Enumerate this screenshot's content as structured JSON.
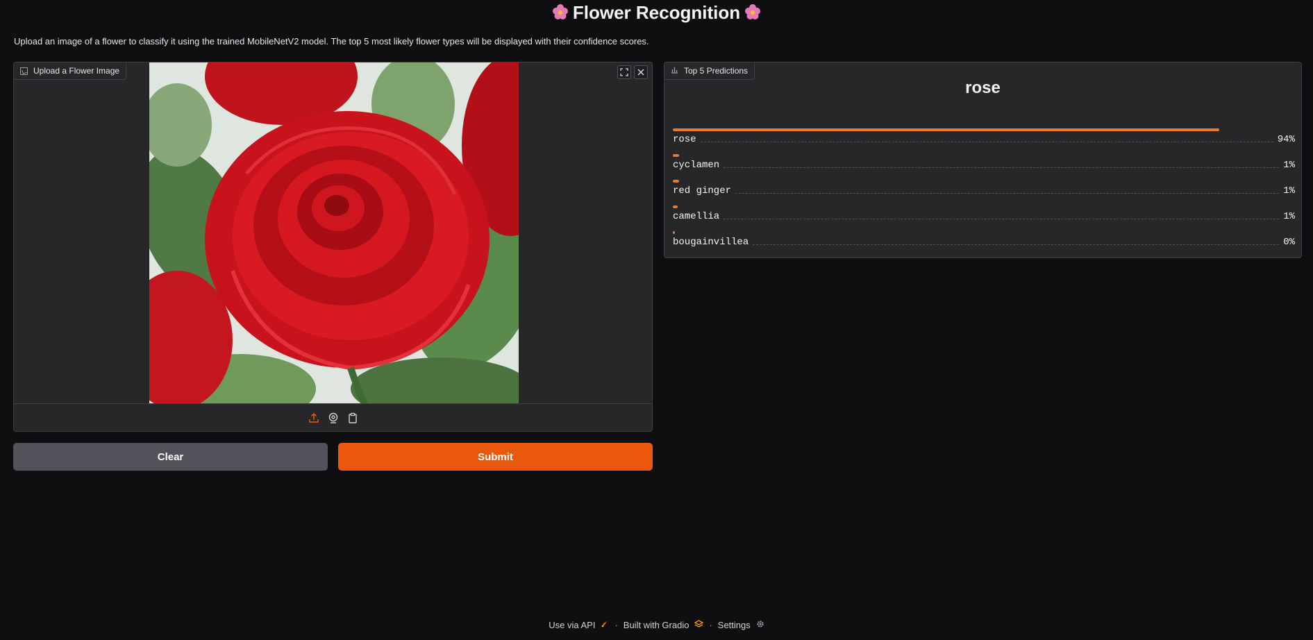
{
  "header": {
    "title": "Flower Recognition",
    "description": "Upload an image of a flower to classify it using the trained MobileNetV2 model. The top 5 most likely flower types will be displayed with their confidence scores."
  },
  "image_input": {
    "label": "Upload a Flower Image",
    "icons": [
      "image-icon",
      "fullscreen-icon",
      "close-icon",
      "upload-icon",
      "webcam-icon",
      "clipboard-icon"
    ]
  },
  "buttons": {
    "clear": "Clear",
    "submit": "Submit"
  },
  "predictions": {
    "label": "Top 5 Predictions",
    "top_label": "rose",
    "items": [
      {
        "name": "rose",
        "percent": "94%",
        "fraction": 0.94
      },
      {
        "name": "cyclamen",
        "percent": "1%",
        "fraction": 0.011
      },
      {
        "name": "red ginger",
        "percent": "1%",
        "fraction": 0.011
      },
      {
        "name": "camellia",
        "percent": "1%",
        "fraction": 0.008
      },
      {
        "name": "bougainvillea",
        "percent": "0%",
        "fraction": 0.004
      }
    ]
  },
  "footer": {
    "api": "Use via API",
    "built": "Built with Gradio",
    "settings": "Settings"
  },
  "colors": {
    "accent": "#ea580c",
    "background": "#0f0f11",
    "panel": "#27272a"
  }
}
